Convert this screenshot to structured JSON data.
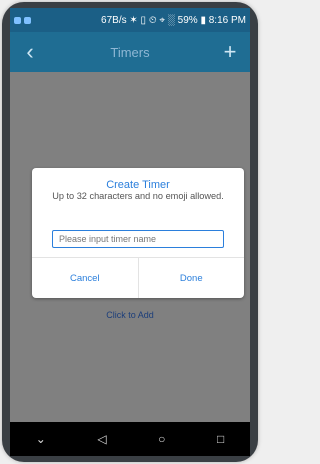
{
  "status_bar": {
    "text": "67B/s ✶ ▯ ⏲ ⌖ ░ 59% ▮ 8:16 PM"
  },
  "app_bar": {
    "title": "Timers",
    "back_glyph": "‹",
    "add_glyph": "+"
  },
  "content": {
    "hint": "Click to Add"
  },
  "dialog": {
    "title": "Create Timer",
    "message": "Up to 32 characters and no emoji allowed.",
    "input_value": "",
    "input_placeholder": "Please input timer name",
    "cancel_label": "Cancel",
    "done_label": "Done"
  },
  "nav": {
    "down": "⌄",
    "back": "◁",
    "home": "○",
    "recents": "□"
  },
  "colors": {
    "accent": "#2b7fdc",
    "app_bar": "#1f6d93",
    "status_bar": "#1b5f86",
    "scrim": "#808080",
    "hint": "#1c3e7a"
  }
}
